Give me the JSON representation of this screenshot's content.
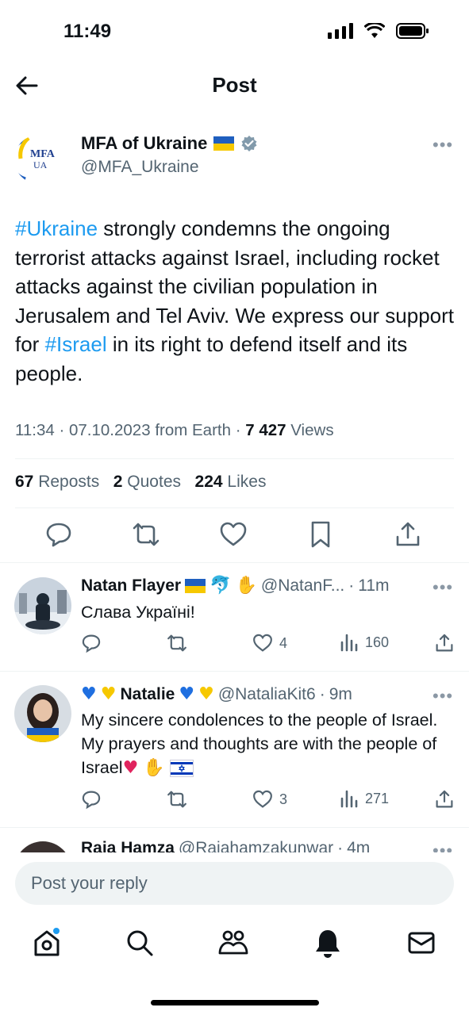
{
  "status_bar": {
    "time": "11:49"
  },
  "header": {
    "title": "Post"
  },
  "tweet": {
    "author_name": "MFA of Ukraine",
    "author_handle": "@MFA_Ukraine",
    "avatar_text": "MFA",
    "avatar_subtext": "UA",
    "text_parts": [
      {
        "text": "#Ukraine",
        "tag": true
      },
      {
        "text": " strongly condemns the ongoing terrorist attacks against Israel, including rocket attacks against the civilian population in Jerusalem and Tel Aviv. We express our support for ",
        "tag": false
      },
      {
        "text": "#Israel",
        "tag": true
      },
      {
        "text": " in its right to defend itself and its people.",
        "tag": false
      }
    ],
    "time": "11:34",
    "date": "07.10.2023",
    "source": "from Earth",
    "views_count": "7 427",
    "views_label": "Views",
    "reposts_count": "67",
    "reposts_label": "Reposts",
    "quotes_count": "2",
    "quotes_label": "Quotes",
    "likes_count": "224",
    "likes_label": "Likes"
  },
  "replies": [
    {
      "name": "Natan Flayer",
      "handle": "@NatanF...",
      "age": "11m",
      "text": "Слава Україні!",
      "likes": "4",
      "views": "160"
    },
    {
      "name": "Natalie",
      "handle": "@NataliaKit6",
      "age": "9m",
      "text": "My sincere condolences to the people of Israel. My prayers and thoughts are with the people of Israel",
      "likes": "3",
      "views": "271"
    },
    {
      "name": "Raja Hamza",
      "handle": "@Rajahamzakunwar",
      "age": "4m"
    }
  ],
  "reply_input": {
    "placeholder": "Post your reply"
  },
  "colors": {
    "accent": "#1d9bf0",
    "secondary_text": "#536471",
    "divider": "#eff3f4"
  }
}
